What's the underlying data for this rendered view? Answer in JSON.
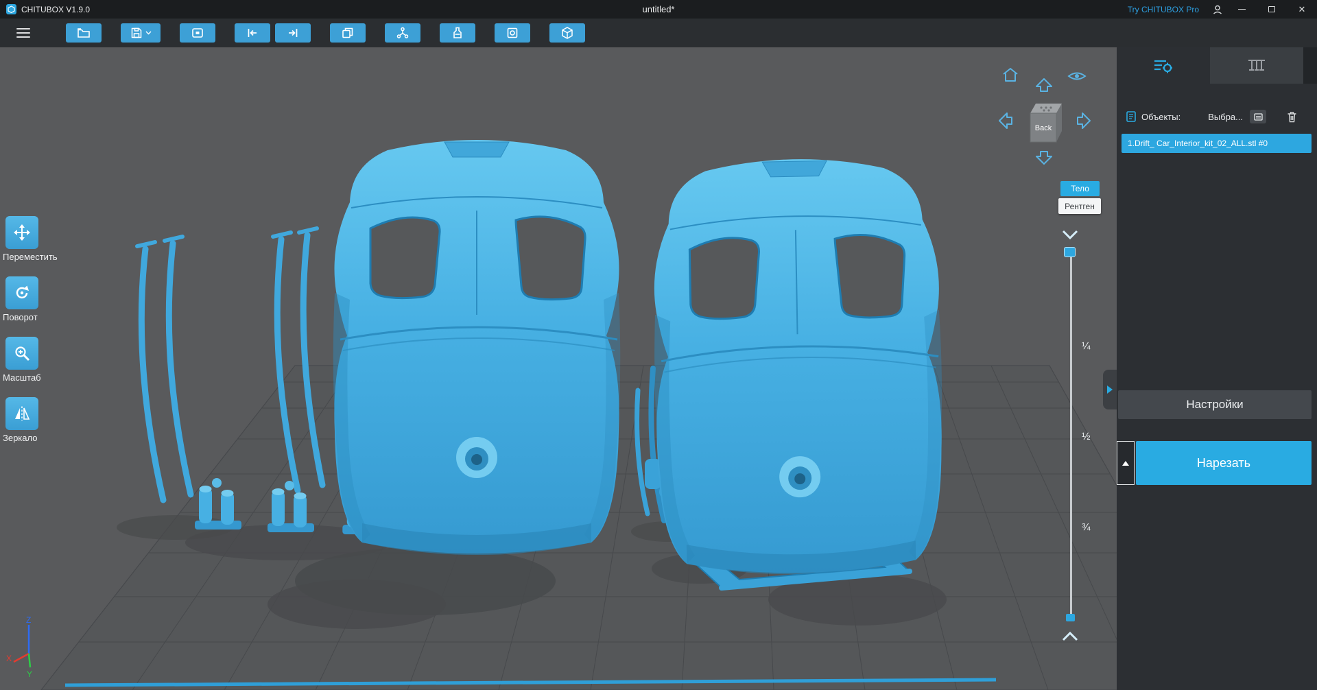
{
  "titlebar": {
    "app_title": "CHITUBOX V1.9.0",
    "doc_title": "untitled*",
    "pro_link": "Try CHITUBOX Pro"
  },
  "toolbar": {
    "buttons": [
      "open-file",
      "save",
      "screenshot",
      "undo",
      "redo",
      "clone",
      "support",
      "hollow",
      "dig-hole",
      "export"
    ]
  },
  "tools": {
    "items": [
      {
        "label": "Переместить"
      },
      {
        "label": "Поворот"
      },
      {
        "label": "Масштаб"
      },
      {
        "label": "Зеркало"
      }
    ]
  },
  "viewport": {
    "cube_face": "Back",
    "mode_body": "Тело",
    "mode_xray": "Рентген",
    "slider_marks": [
      "¼",
      "½",
      "¾"
    ],
    "axes": {
      "x": "X",
      "y": "Y",
      "z": "Z"
    }
  },
  "panel": {
    "objects_label": "Объекты:",
    "selected_label": "Выбра...",
    "file_item": "1.Drift_ Car_Interior_kit_02_ALL.stl #0",
    "settings_button": "Настройки",
    "slice_button": "Нарезать"
  },
  "colors": {
    "accent": "#29abe2",
    "model": "#47b0e3",
    "canvas_bg": "#595a5c"
  }
}
